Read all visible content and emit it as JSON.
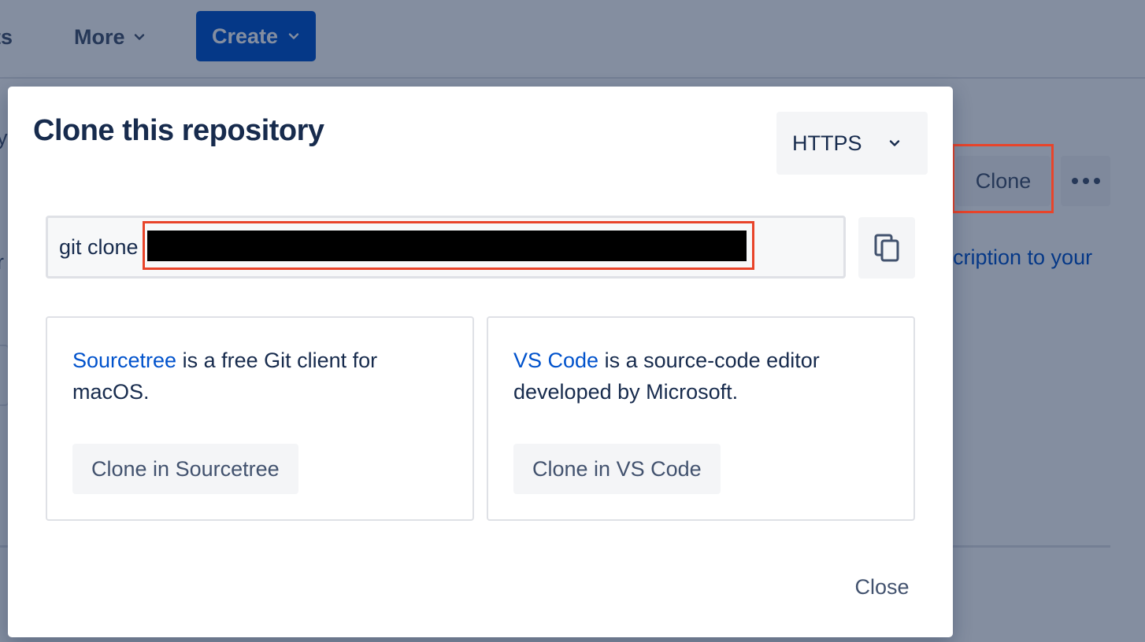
{
  "topnav": {
    "projects_partial": "ects",
    "more_label": "More",
    "create_label": "Create"
  },
  "page": {
    "clone_button_label": "Clone",
    "description_link_partial": "cription to your",
    "edge_fragment_r": "r",
    "edge_fragment_y": "y"
  },
  "modal": {
    "title": "Clone this repository",
    "protocol": {
      "selected": "HTTPS"
    },
    "clone_command_prefix": "git clone",
    "clients": [
      {
        "link_text": "Sourcetree",
        "description": " is a free Git client for macOS.",
        "button_label": "Clone in Sourcetree"
      },
      {
        "link_text": "VS Code",
        "description": " is a source-code editor developed by Microsoft.",
        "button_label": "Clone in VS Code"
      }
    ],
    "close_label": "Close"
  },
  "colors": {
    "primary": "#0052cc",
    "highlight": "#e8442a",
    "text": "#172b4d",
    "subtle_text": "#42526e",
    "button_bg": "#f4f5f7",
    "overlay": "rgba(9, 30, 66, 0.50)"
  },
  "icons": {
    "more_chevron": "chevron-down-icon",
    "create_chevron": "chevron-down-icon",
    "protocol_chevron": "chevron-down-icon",
    "copy": "copy-icon",
    "more_actions": "more-horizontal-icon"
  }
}
